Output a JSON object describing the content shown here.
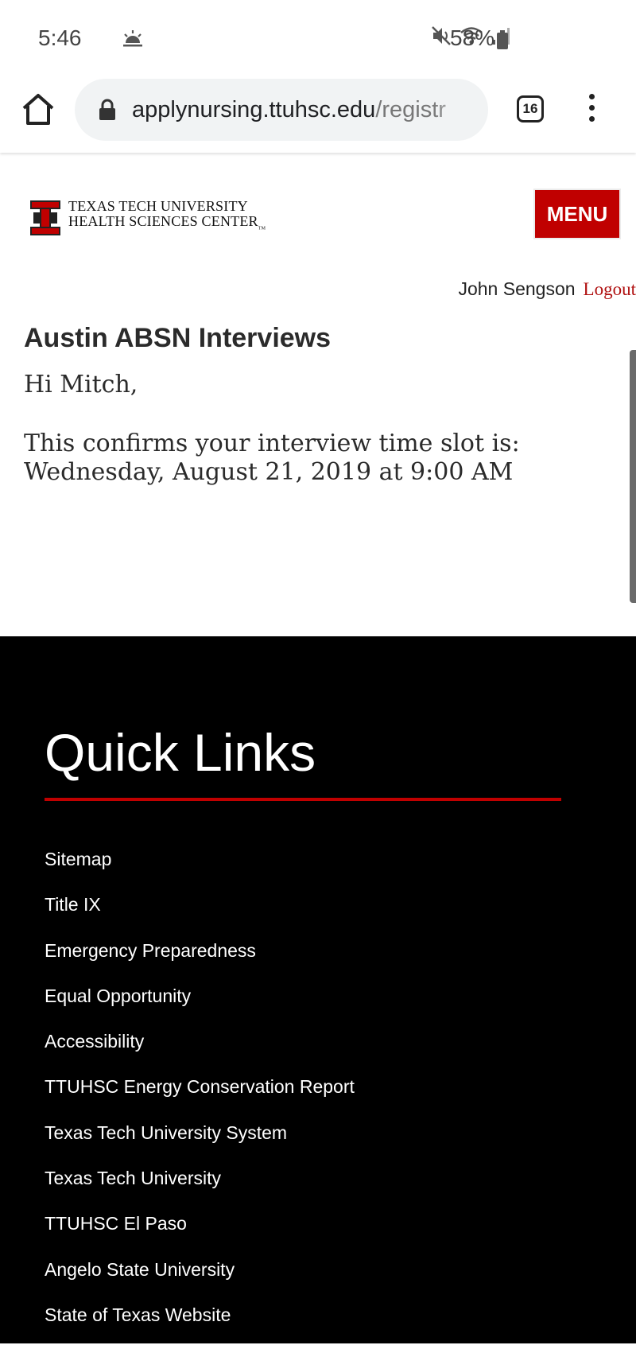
{
  "status_bar": {
    "time": "5:46",
    "battery_percent": "58%"
  },
  "browser": {
    "url_domain": "applynursing.ttuhsc.edu",
    "url_path": "/registr",
    "tab_count": "16"
  },
  "header": {
    "logo_line1": "TEXAS TECH UNIVERSITY",
    "logo_line2": "HEALTH SCIENCES CENTER",
    "logo_tm": "TM",
    "menu_label": "MENU",
    "brand_color": "#c00000"
  },
  "user": {
    "name": "John Sengson",
    "logout_label": "Logout"
  },
  "main": {
    "title": "Austin ABSN Interviews",
    "greeting": "Hi Mitch,",
    "confirm_line1": "This confirms your interview time slot is:",
    "confirm_line2": "Wednesday, August 21, 2019 at 9:00 AM"
  },
  "footer": {
    "title": "Quick Links",
    "links": [
      "Sitemap",
      "Title IX",
      "Emergency Preparedness",
      "Equal Opportunity",
      "Accessibility",
      "TTUHSC Energy Conservation Report",
      "Texas Tech University System",
      "Texas Tech University",
      "TTUHSC El Paso",
      "Angelo State University",
      "State of Texas Website"
    ]
  }
}
